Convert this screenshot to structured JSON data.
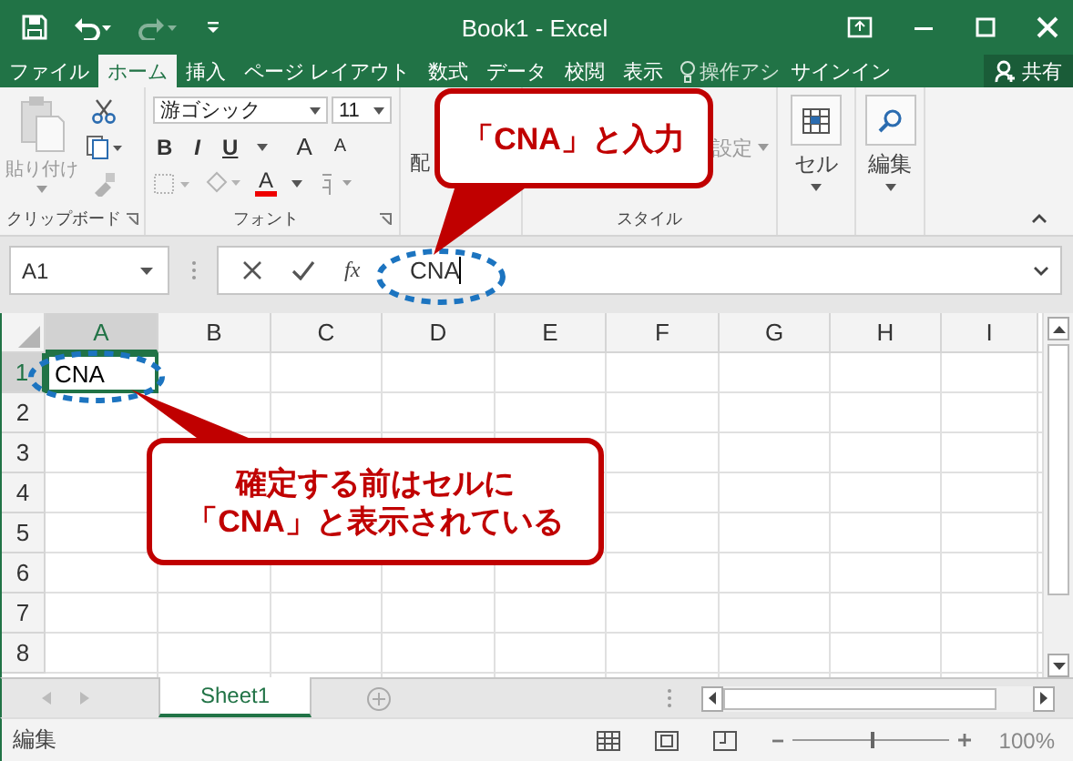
{
  "window": {
    "title": "Book1 - Excel"
  },
  "tabs": [
    {
      "label": "ファイル",
      "selected": false
    },
    {
      "label": "ホーム",
      "selected": true
    },
    {
      "label": "挿入",
      "selected": false
    },
    {
      "label": "ページ レイアウト",
      "selected": false
    },
    {
      "label": "数式",
      "selected": false
    },
    {
      "label": "データ",
      "selected": false
    },
    {
      "label": "校閲",
      "selected": false
    },
    {
      "label": "表示",
      "selected": false
    }
  ],
  "tell_me": "操作アシ",
  "sign_in": "サインイン",
  "share": "共有",
  "ribbon": {
    "paste": "貼り付け",
    "font_name": "游ゴシック",
    "font_size": "11",
    "bold": "B",
    "italic": "I",
    "underline": "U",
    "grow": "A",
    "shrink": "A",
    "font_color": "A",
    "alignment_partial": "配",
    "format_partial": "設定",
    "cells": "セル",
    "editing": "編集",
    "groups": [
      "クリップボード",
      "フォント",
      "スタイル"
    ]
  },
  "formula_bar": {
    "name_box": "A1",
    "fx": "fx",
    "value": "CNA"
  },
  "sheet": {
    "columns": [
      {
        "label": "A",
        "selected": true
      },
      {
        "label": "B",
        "selected": false
      },
      {
        "label": "C",
        "selected": false
      },
      {
        "label": "D",
        "selected": false
      },
      {
        "label": "E",
        "selected": false
      },
      {
        "label": "F",
        "selected": false
      },
      {
        "label": "G",
        "selected": false
      },
      {
        "label": "H",
        "selected": false
      },
      {
        "label": "I",
        "selected": false
      }
    ],
    "rows": [
      {
        "label": "1",
        "selected": true
      },
      {
        "label": "2",
        "selected": false
      },
      {
        "label": "3",
        "selected": false
      },
      {
        "label": "4",
        "selected": false
      },
      {
        "label": "5",
        "selected": false
      },
      {
        "label": "6",
        "selected": false
      },
      {
        "label": "7",
        "selected": false
      },
      {
        "label": "8",
        "selected": false
      }
    ],
    "active_cell": "CNA"
  },
  "sheet_tabs": [
    {
      "label": "Sheet1",
      "selected": true
    }
  ],
  "status_bar": {
    "mode": "編集",
    "zoom": "100%",
    "zoom_slider": {
      "level": 0.5
    }
  },
  "callouts": [
    {
      "lines": [
        "「CNA」と入力"
      ]
    },
    {
      "lines": [
        "確定する前はセルに",
        "「CNA」と表示されている"
      ]
    }
  ]
}
